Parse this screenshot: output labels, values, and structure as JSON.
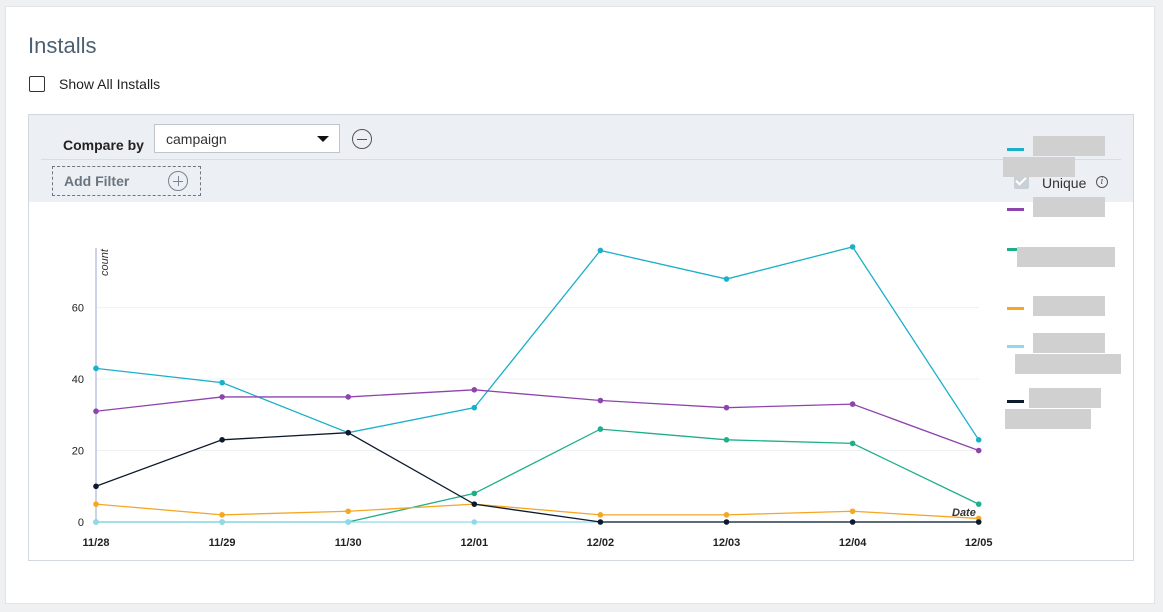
{
  "header": {
    "title": "Installs"
  },
  "show_all": {
    "label": "Show All Installs",
    "checked": false
  },
  "filters": {
    "compare_by_label": "Compare by",
    "compare_by_value": "campaign",
    "add_filter_label": "Add Filter",
    "unique_label": "Unique",
    "unique_checked": true,
    "info_glyph": "i"
  },
  "chart_data": {
    "type": "line",
    "categories": [
      "11/28",
      "11/29",
      "11/30",
      "12/01",
      "12/02",
      "12/03",
      "12/04",
      "12/05"
    ],
    "xlabel": "Date",
    "ylabel": "count",
    "yticks": [
      0,
      20,
      40,
      60
    ],
    "ylim": [
      0,
      77
    ],
    "grid": true,
    "legend_placement": "right",
    "series": [
      {
        "color": "#1ab0c8",
        "values": [
          43,
          39,
          25,
          32,
          76,
          68,
          77,
          23
        ]
      },
      {
        "color": "#8e44ad",
        "values": [
          31,
          35,
          35,
          37,
          34,
          32,
          33,
          20
        ]
      },
      {
        "color": "#1fae8a",
        "values": [
          0,
          0,
          0,
          8,
          26,
          23,
          22,
          5
        ]
      },
      {
        "color": "#f5a623",
        "values": [
          5,
          2,
          3,
          5,
          2,
          2,
          3,
          1
        ]
      },
      {
        "color": "#8fdaea",
        "values": [
          0,
          0,
          0,
          0,
          0,
          0,
          0,
          0
        ]
      },
      {
        "color": "#0d1a2e",
        "values": [
          10,
          23,
          25,
          5,
          0,
          0,
          0,
          0
        ]
      }
    ]
  }
}
